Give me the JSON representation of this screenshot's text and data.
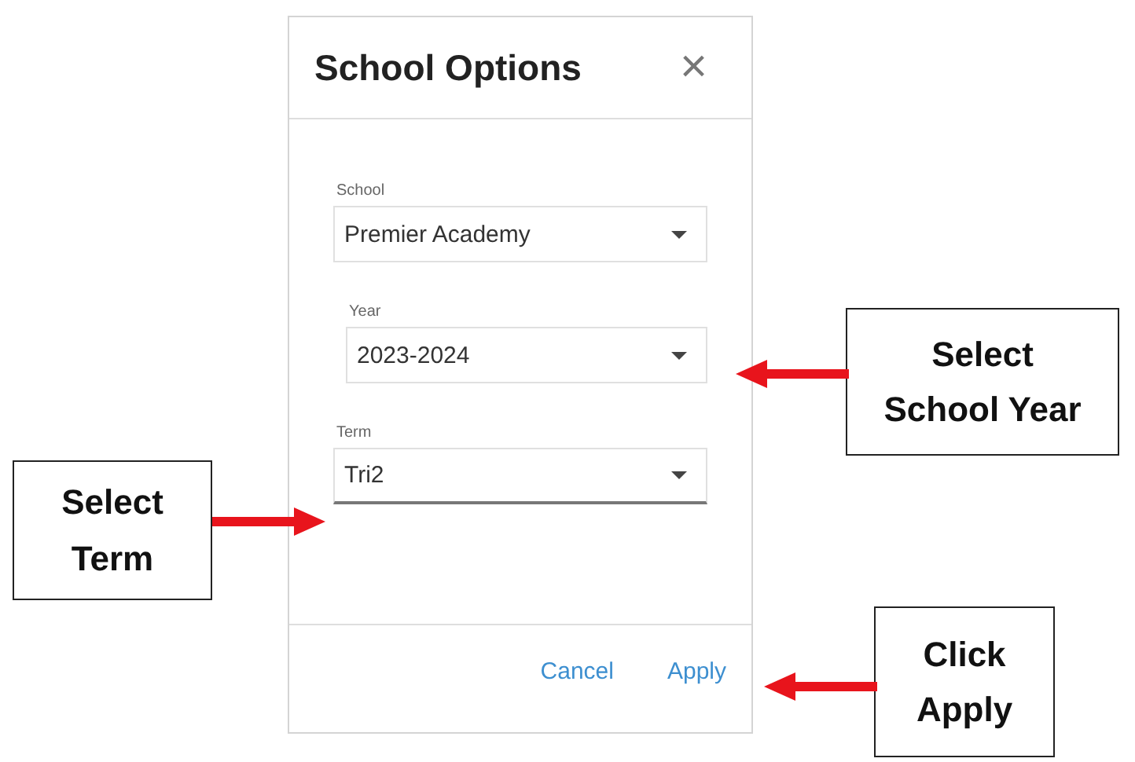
{
  "dialog": {
    "title": "School Options",
    "close": "×",
    "fields": [
      {
        "label": "School",
        "value": "Premier Academy",
        "focused": false
      },
      {
        "label": "Year",
        "value": "2023-2024",
        "focused": false
      },
      {
        "label": "Term",
        "value": "Tri2",
        "focused": true
      }
    ],
    "buttons": [
      "Cancel",
      "Apply"
    ]
  },
  "callouts": [
    {
      "lines": [
        "Select",
        "School Year"
      ]
    },
    {
      "lines": [
        "Select",
        "Term"
      ]
    },
    {
      "lines": [
        "Click",
        "Apply"
      ]
    }
  ]
}
